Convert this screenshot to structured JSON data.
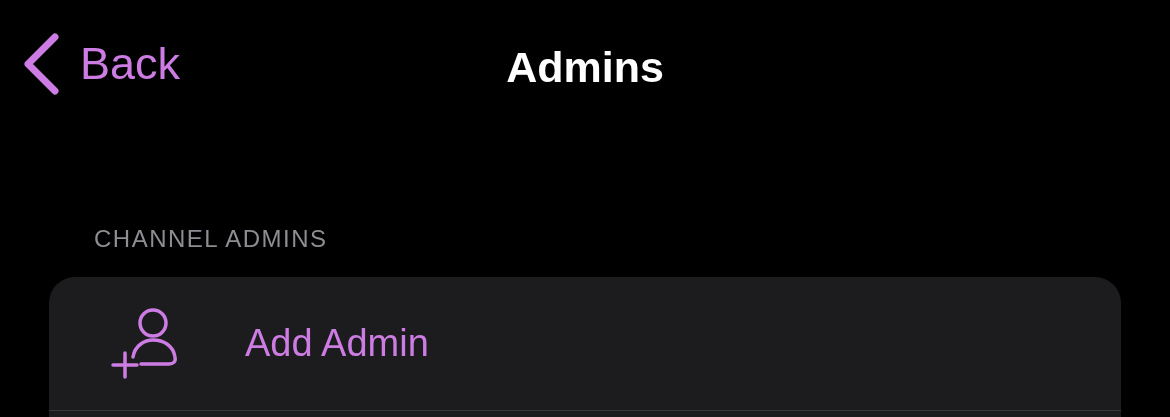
{
  "nav": {
    "back_label": "Back",
    "title": "Admins"
  },
  "section": {
    "header": "CHANNEL ADMINS",
    "rows": [
      {
        "kind": "action",
        "label": "Add Admin"
      }
    ]
  }
}
